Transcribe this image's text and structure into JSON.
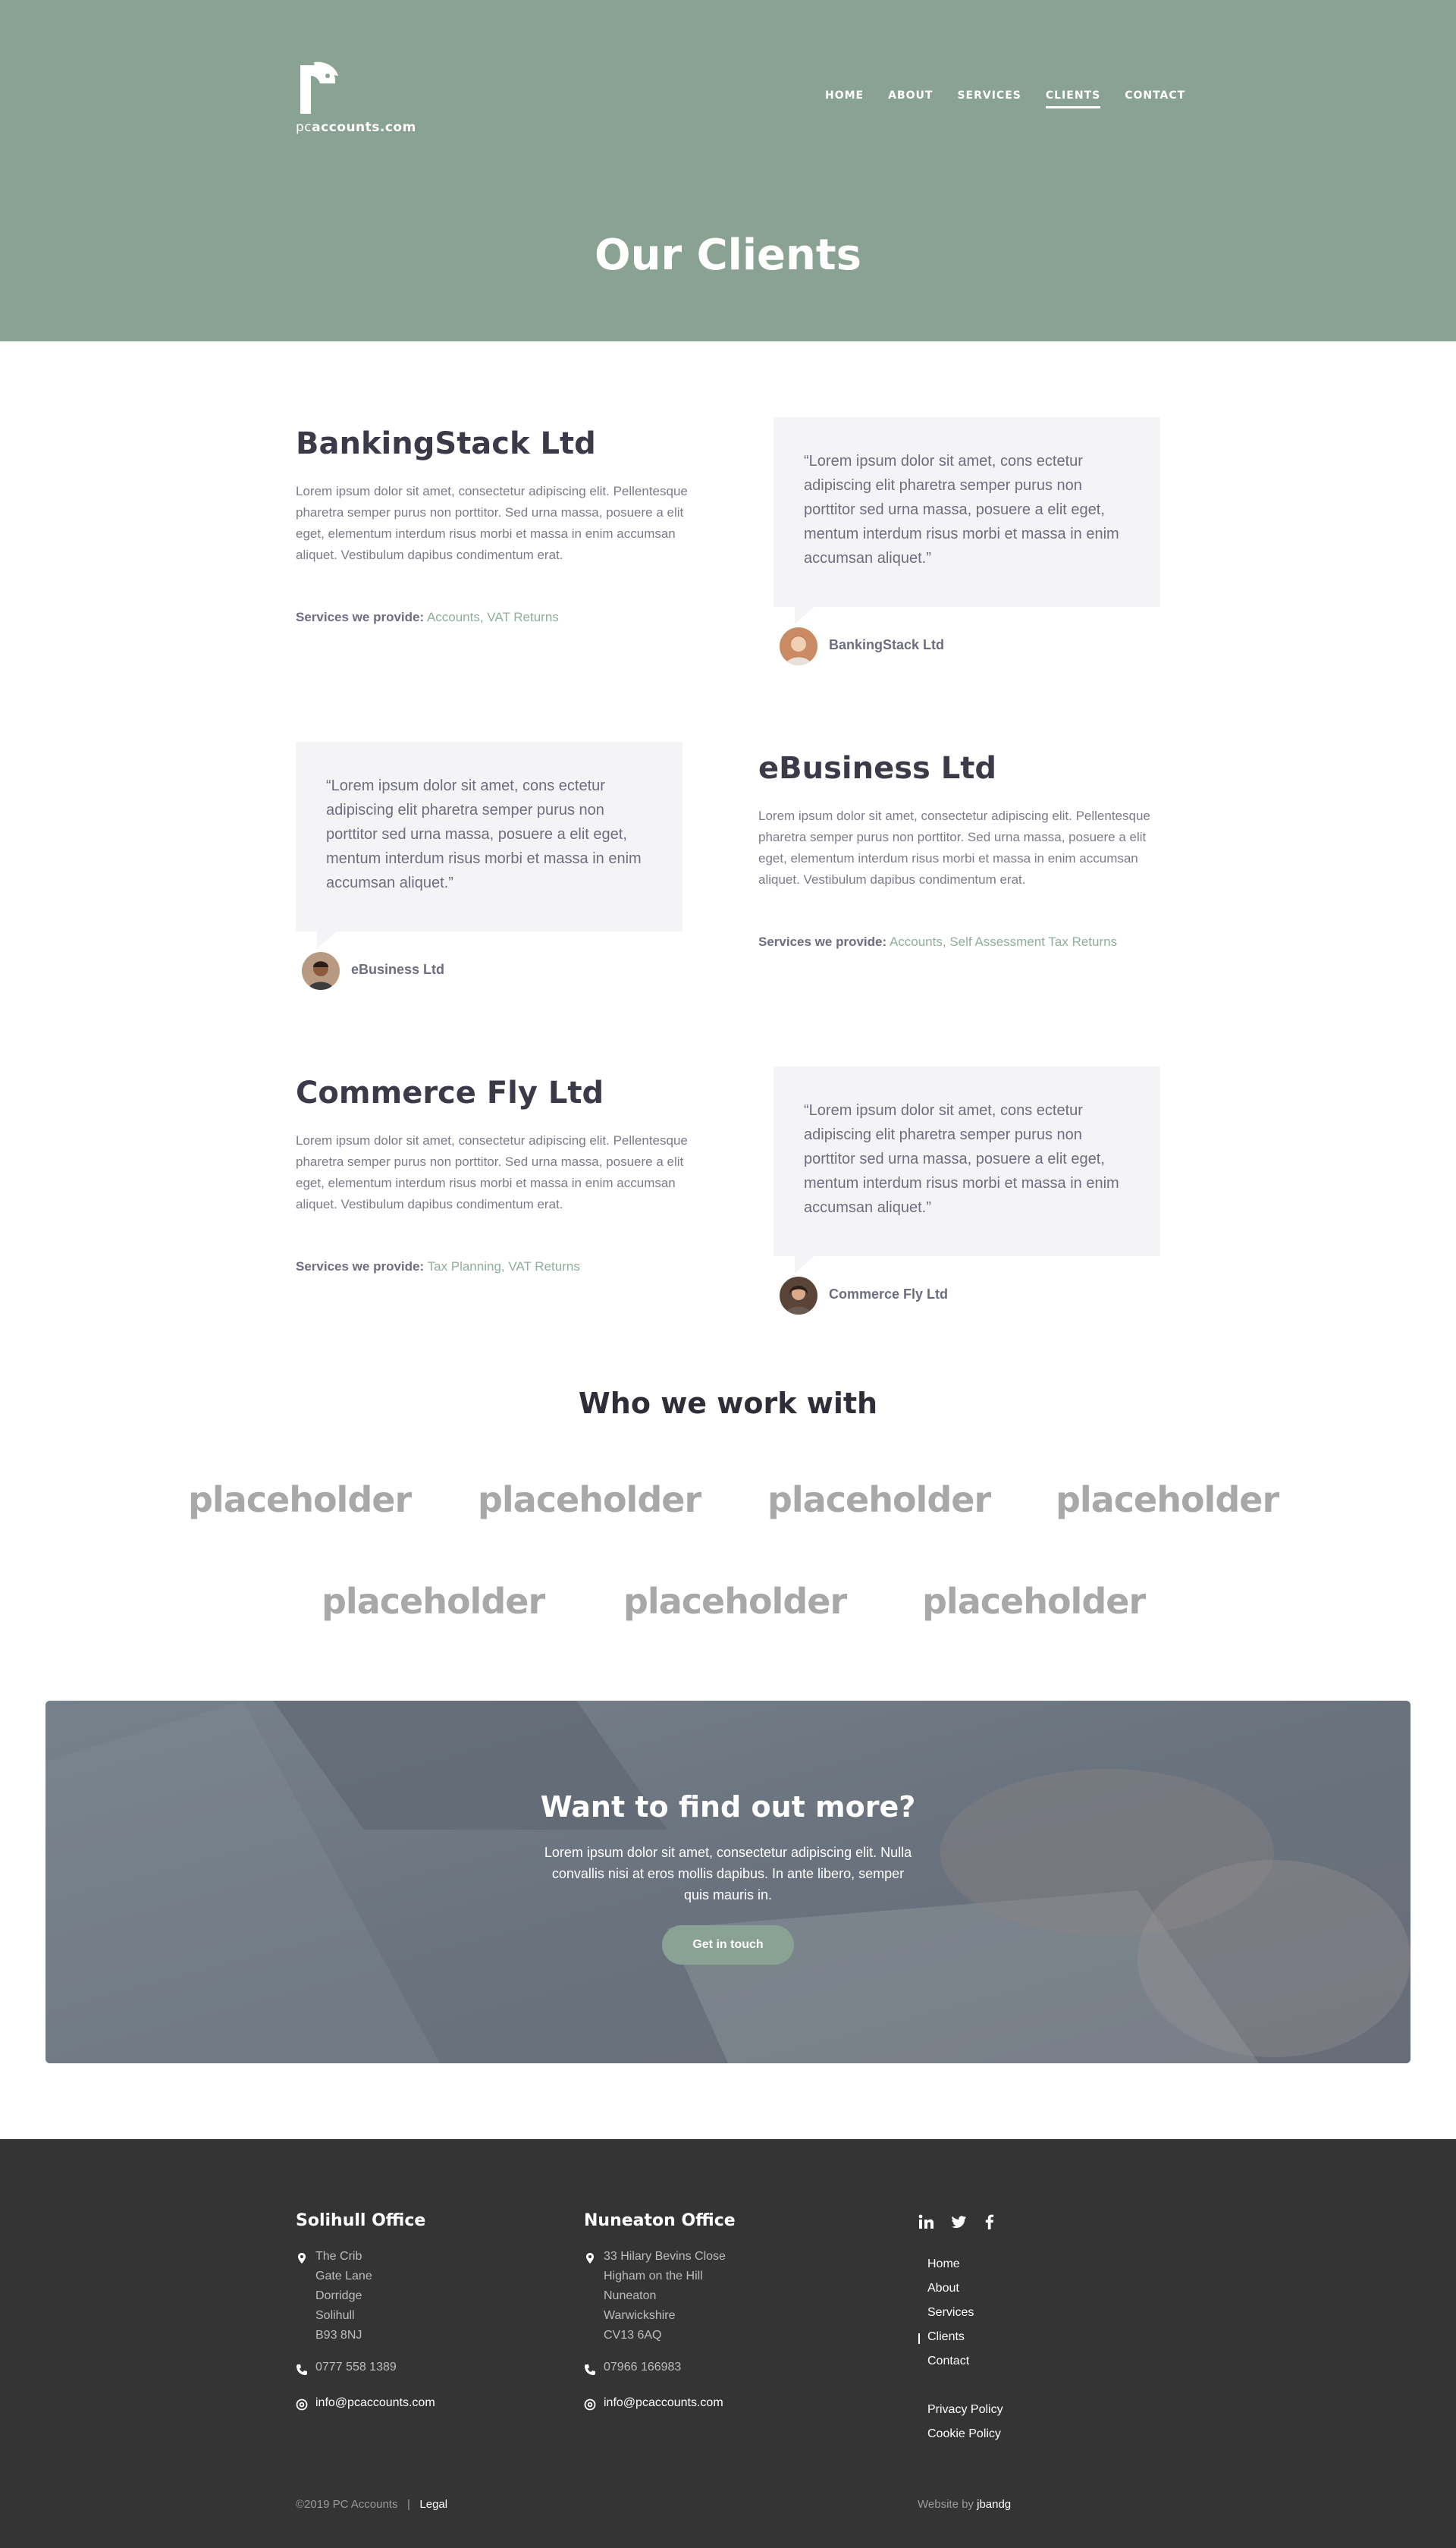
{
  "brand": {
    "logo_prefix": "pc",
    "logo_main": "accounts.com"
  },
  "nav": {
    "items": [
      {
        "label": "HOME"
      },
      {
        "label": "ABOUT"
      },
      {
        "label": "SERVICES"
      },
      {
        "label": "CLIENTS",
        "active": true
      },
      {
        "label": "CONTACT"
      }
    ]
  },
  "hero": {
    "title": "Our Clients"
  },
  "clients": [
    {
      "name": "BankingStack Ltd",
      "description": "Lorem ipsum dolor sit amet, consectetur adipiscing elit. Pellentesque pharetra semper purus non porttitor. Sed urna massa, posuere a elit eget, elementum interdum risus morbi et massa in enim accumsan aliquet. Vestibulum dapibus condimentum erat.",
      "services_label": "Services we provide:",
      "services": "Accounts, VAT Returns",
      "quote": "“Lorem ipsum dolor sit amet, cons ectetur adipiscing elit pharetra semper purus non porttitor sed urna massa, posuere a elit eget, mentum interdum risus morbi et massa in enim accumsan aliquet.”",
      "author": "BankingStack Ltd"
    },
    {
      "name": "eBusiness Ltd",
      "description": "Lorem ipsum dolor sit amet, consectetur adipiscing elit. Pellentesque pharetra semper purus non porttitor. Sed urna massa, posuere a elit eget, elementum interdum risus morbi et massa in enim accumsan aliquet. Vestibulum dapibus condimentum erat.",
      "services_label": "Services we provide:",
      "services": "Accounts, Self Assessment Tax Returns",
      "quote": "“Lorem ipsum dolor sit amet, cons ectetur adipiscing elit pharetra semper purus non porttitor sed urna massa, posuere a elit eget, mentum interdum risus morbi et massa in enim accumsan aliquet.”",
      "author": "eBusiness Ltd"
    },
    {
      "name": "Commerce Fly Ltd",
      "description": "Lorem ipsum dolor sit amet, consectetur adipiscing elit. Pellentesque pharetra semper purus non porttitor. Sed urna massa, posuere a elit eget, elementum interdum risus morbi et massa in enim accumsan aliquet. Vestibulum dapibus condimentum erat.",
      "services_label": "Services we provide:",
      "services": "Tax Planning, VAT Returns",
      "quote": "“Lorem ipsum dolor sit amet, cons ectetur adipiscing elit pharetra semper purus non porttitor sed urna massa, posuere a elit eget, mentum interdum risus morbi et massa in enim accumsan aliquet.”",
      "author": "Commerce Fly Ltd"
    }
  ],
  "partners": {
    "title": "Who we work with",
    "logos": [
      "placeholder",
      "placeholder",
      "placeholder",
      "placeholder",
      "placeholder",
      "placeholder",
      "placeholder"
    ]
  },
  "cta": {
    "title": "Want to find out more?",
    "text": "Lorem ipsum dolor sit amet, consectetur adipiscing elit. Nulla convallis nisi at eros mollis dapibus. In ante libero, semper quis mauris in.",
    "button": "Get in touch"
  },
  "footer": {
    "solihull": {
      "title": "Solihull Office",
      "address": [
        "The Crib",
        "Gate Lane",
        "Dorridge",
        "Solihull",
        "B93 8NJ"
      ],
      "phone": "0777 558 1389",
      "email": "info@pcaccounts.com"
    },
    "nuneaton": {
      "title": "Nuneaton Office",
      "address": [
        "33 Hilary Bevins Close",
        "Higham on the Hill",
        "Nuneaton",
        "Warwickshire",
        "CV13 6AQ"
      ],
      "phone": "07966 166983",
      "email": "info@pcaccounts.com"
    },
    "social": [
      "linkedin-icon",
      "twitter-icon",
      "facebook-icon"
    ],
    "links": [
      "Home",
      "About",
      "Services",
      "Clients",
      "Contact"
    ],
    "legal_links": [
      "Privacy Policy",
      "Cookie Policy"
    ],
    "copyright": "©2019 PC Accounts",
    "separator": "|",
    "legal": "Legal",
    "credit_prefix": "Website by",
    "credit_name": "jbandg"
  },
  "colors": {
    "hero_bg": "#8aa293",
    "accent": "#8fae9b",
    "footer_bg": "#343434",
    "quote_bg": "#f4f4f6"
  }
}
